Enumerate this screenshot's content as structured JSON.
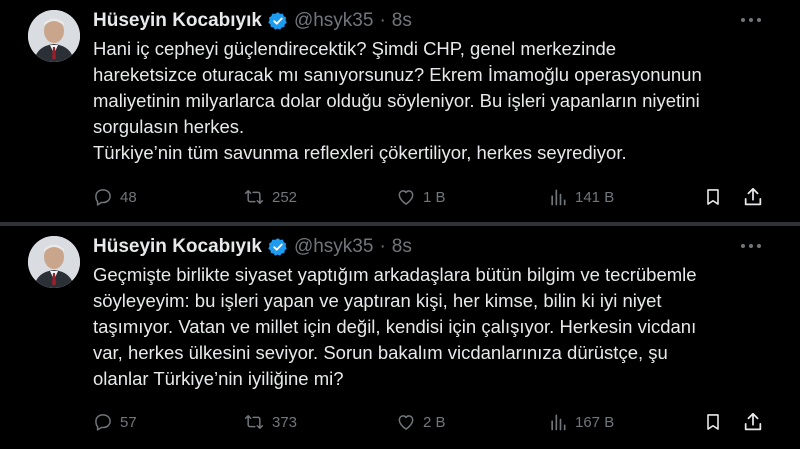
{
  "tweets": [
    {
      "author": {
        "name": "Hüseyin Kocabıyık",
        "handle": "@hsyk35",
        "time": "8s",
        "verified_color": "#1d9bf0"
      },
      "text_lines": [
        "Hani iç cepheyi güçlendirecektik? Şimdi CHP, genel merkezinde",
        "hareketsizce oturacak mı sanıyorsunuz? Ekrem İmamoğlu operasyonunun",
        "maliyetinin milyarlarca dolar olduğu söyleniyor. Bu işleri yapanların niyetini",
        "sorgulasın herkes.",
        "Türkiye’nin tüm savunma reflexleri çökertiliyor, herkes seyrediyor."
      ],
      "stats": {
        "replies": "48",
        "reposts": "252",
        "likes": "1 B",
        "views": "141 B"
      }
    },
    {
      "author": {
        "name": "Hüseyin Kocabıyık",
        "handle": "@hsyk35",
        "time": "8s",
        "verified_color": "#1d9bf0"
      },
      "text_lines": [
        "Geçmişte birlikte siyaset yaptığım arkadaşlara bütün bilgim ve tecrübemle",
        "söyleyeyim: bu işleri yapan ve yaptıran kişi, her kimse, bilin ki iyi niyet",
        "taşımıyor. Vatan ve millet için değil, kendisi için çalışıyor. Herkesin vicdanı",
        "var, herkes ülkesini seviyor. Sorun bakalım vicdanlarınıza dürüstçe, şu",
        "olanlar Türkiye’nin iyiliğine mi?"
      ],
      "stats": {
        "replies": "57",
        "reposts": "373",
        "likes": "2 B",
        "views": "167 B"
      }
    }
  ],
  "icons": {
    "verified": "verified-badge-icon",
    "more": "more-options-icon",
    "reply": "reply-icon",
    "repost": "repost-icon",
    "like": "like-icon",
    "views": "views-icon",
    "bookmark": "bookmark-icon",
    "share": "share-icon"
  },
  "colors": {
    "background": "#000000",
    "text": "#e7e9ea",
    "muted": "#71767b",
    "divider": "#2f3336",
    "accent": "#1d9bf0"
  }
}
